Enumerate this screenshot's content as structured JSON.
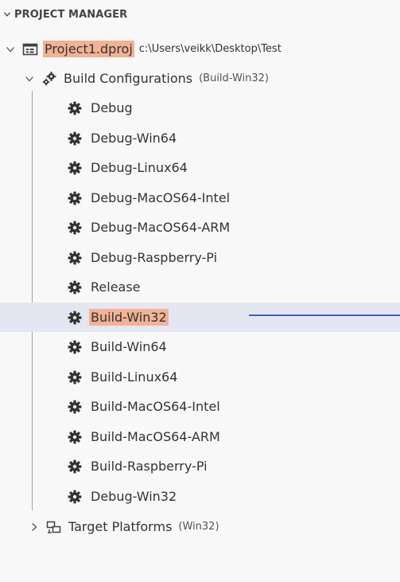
{
  "section": {
    "title": "PROJECT MANAGER",
    "icon": "chevron-down-icon"
  },
  "project": {
    "name": "Project1.dproj",
    "path": "c:\\Users\\veikk\\Desktop\\Test",
    "icon": "project-window-icon",
    "expanded": true
  },
  "build_configurations": {
    "label": "Build Configurations",
    "current": "(Build-Win32)",
    "icon": "gears-icon",
    "expanded": true,
    "items": [
      {
        "label": "Debug"
      },
      {
        "label": "Debug-Win64"
      },
      {
        "label": "Debug-Linux64"
      },
      {
        "label": "Debug-MacOS64-Intel"
      },
      {
        "label": "Debug-MacOS64-ARM"
      },
      {
        "label": "Debug-Raspberry-Pi"
      },
      {
        "label": "Release"
      },
      {
        "label": "Build-Win32"
      },
      {
        "label": "Build-Win64"
      },
      {
        "label": "Build-Linux64"
      },
      {
        "label": "Build-MacOS64-Intel"
      },
      {
        "label": "Build-MacOS64-ARM"
      },
      {
        "label": "Build-Raspberry-Pi"
      },
      {
        "label": "Debug-Win32"
      }
    ],
    "selected_index": 7
  },
  "target_platforms": {
    "label": "Target Platforms",
    "current": "(Win32)",
    "icon": "platforms-icon",
    "expanded": false
  },
  "colors": {
    "highlight": "#f2b295",
    "selection": "#e4e6f1",
    "connector": "#3e63b3"
  }
}
